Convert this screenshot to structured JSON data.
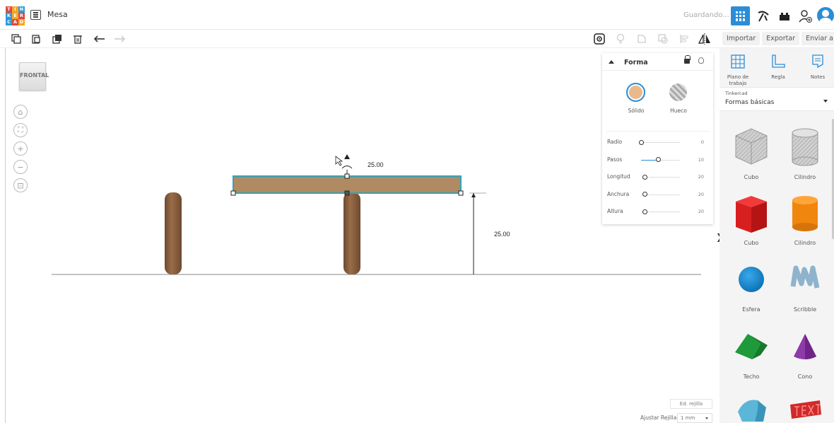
{
  "header": {
    "logo_letters": [
      "T",
      "I",
      "N",
      "K",
      "E",
      "R",
      "C",
      "A",
      "D"
    ],
    "logo_colors": [
      "#e0483e",
      "#f5a623",
      "#2c9ad8",
      "#2c9ad8",
      "#f5a623",
      "#e0483e",
      "#2c9ad8",
      "#e0483e",
      "#f5a623"
    ],
    "design_name": "Mesa",
    "status": "Guardando...",
    "accent": "#2b8dd6"
  },
  "toolbar": {
    "tools": [
      "copy-icon",
      "paste-icon",
      "duplicate-icon",
      "trash-icon",
      "undo-icon",
      "redo-icon"
    ],
    "right_tools": [
      "notes-eye-icon",
      "light-bulb-icon",
      "group-icon",
      "ungroup-icon",
      "align-icon",
      "mirror-icon"
    ]
  },
  "actions": {
    "import": "Importar",
    "export": "Exportar",
    "send": "Enviar a"
  },
  "viewcube": {
    "label": "FRONTAL"
  },
  "nav": [
    "home-icon",
    "fit-icon",
    "zoom-in-icon",
    "zoom-out-icon",
    "perspective-icon"
  ],
  "dimensions": {
    "width_label": "25.00",
    "height_label": "25.00"
  },
  "shape_panel": {
    "title": "Forma",
    "solid_label": "Sólido",
    "hole_label": "Hueco",
    "solid_color": "#e8b98a",
    "properties": [
      {
        "name": "Radio",
        "value": "0",
        "fraction": 0.0
      },
      {
        "name": "Pasos",
        "value": "10",
        "fraction": 0.45
      },
      {
        "name": "Longitud",
        "value": "20",
        "fraction": 0.1
      },
      {
        "name": "Anchura",
        "value": "20",
        "fraction": 0.1
      },
      {
        "name": "Altura",
        "value": "20",
        "fraction": 0.1
      }
    ]
  },
  "grid": {
    "edit_label": "Ed. rejilla",
    "snap_label": "Ajustar Rejilla",
    "snap_value": "1 mm"
  },
  "library": {
    "tabs": [
      {
        "label": "Plano de trabajo",
        "icon": "workplane-icon"
      },
      {
        "label": "Regla",
        "icon": "ruler-icon"
      },
      {
        "label": "Notes",
        "icon": "notes-icon"
      }
    ],
    "provider": "Tinkercad",
    "category": "Formas básicas",
    "shapes": [
      {
        "label": "Cubo",
        "kind": "hole-box"
      },
      {
        "label": "Cilindro",
        "kind": "hole-cylinder"
      },
      {
        "label": "Cubo",
        "kind": "box"
      },
      {
        "label": "Cilindro",
        "kind": "cylinder"
      },
      {
        "label": "Esfera",
        "kind": "sphere"
      },
      {
        "label": "Scribble",
        "kind": "scribble"
      },
      {
        "label": "Techo",
        "kind": "roof"
      },
      {
        "label": "Cono",
        "kind": "cone"
      },
      {
        "label": "",
        "kind": "round-roof"
      },
      {
        "label": "",
        "kind": "text"
      }
    ]
  }
}
